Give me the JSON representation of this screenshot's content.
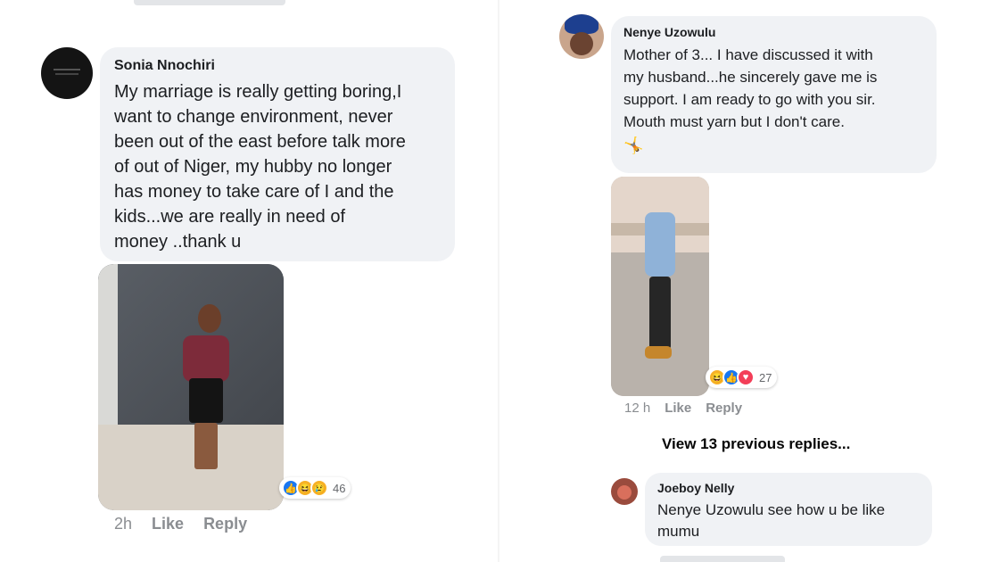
{
  "left": {
    "comment": {
      "author": "Sonia Nnochiri",
      "text": "My marriage is really getting boring,I\nwant to change environment, never\nbeen out of the east before talk more\nof out of Niger, my hubby no longer\nhas money to take care of I and the\nkids...we are really in need of\nmoney ..thank u",
      "reaction_count": "46",
      "reactions": [
        "like-icon",
        "haha-icon",
        "sad-icon"
      ],
      "time": "2h",
      "like_label": "Like",
      "reply_label": "Reply"
    }
  },
  "right": {
    "comment": {
      "author": "Nenye Uzowulu",
      "text": "Mother of 3... I have discussed it with\nmy husband...he sincerely gave me is\nsupport. I am ready to go with you sir.\nMouth must yarn but I don't care.",
      "emoji": "🤸",
      "reaction_count": "27",
      "reactions": [
        "haha-icon",
        "like-icon",
        "love-icon"
      ],
      "time": "12 h",
      "like_label": "Like",
      "reply_label": "Reply"
    },
    "view_previous": "View 13 previous replies...",
    "reply": {
      "author": "Joeboy Nelly",
      "text": "Nenye Uzowulu see how u be like\nmumu"
    }
  },
  "colors": {
    "bubble": "#f0f2f5",
    "like": "#1877f2",
    "love": "#f33e58",
    "meta": "#8a8d91"
  }
}
